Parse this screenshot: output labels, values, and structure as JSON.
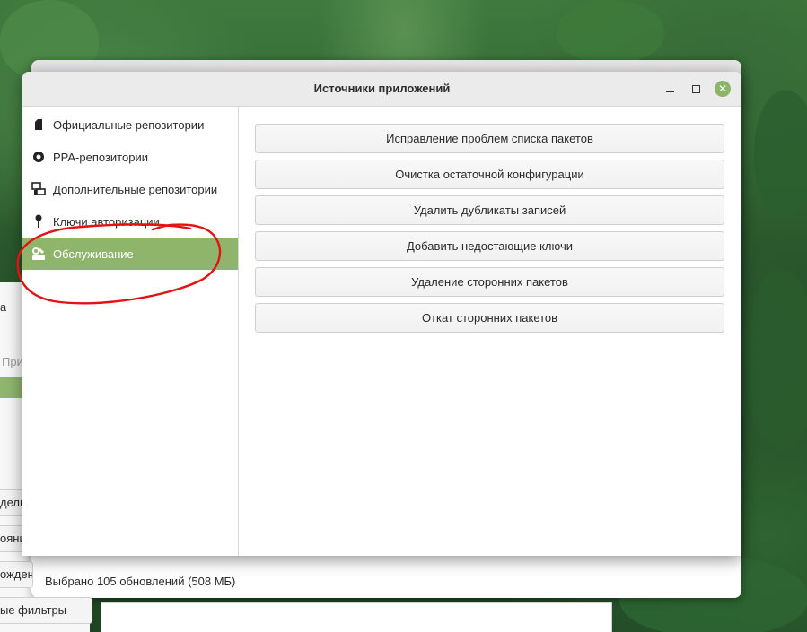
{
  "colors": {
    "accent": "#8fb56d",
    "annotation_red": "#e41212"
  },
  "background_window": {
    "status_text": "Выбрано 105 обновлений (508 МБ)",
    "left_fragments": [
      "а",
      "При",
      "дель",
      "ояни",
      "ожден",
      "ые фильтры"
    ]
  },
  "dialog": {
    "title": "Источники приложений",
    "controls": {
      "minimize_icon": "minimize-icon",
      "maximize_icon": "maximize-icon",
      "close_icon": "close-icon",
      "close_glyph": "✕"
    },
    "sidebar": {
      "items": [
        {
          "label": "Официальные репозитории",
          "icon": "package-icon",
          "selected": false
        },
        {
          "label": "PPA-репозитории",
          "icon": "ppa-icon",
          "selected": false
        },
        {
          "label": "Дополнительные репозитории",
          "icon": "network-icon",
          "selected": false
        },
        {
          "label": "Ключи авторизации",
          "icon": "key-icon",
          "selected": false
        },
        {
          "label": "Обслуживание",
          "icon": "maintenance-icon",
          "selected": true
        }
      ]
    },
    "maintenance": {
      "buttons": [
        "Исправление проблем списка пакетов",
        "Очистка остаточной конфигурации",
        "Удалить дубликаты записей",
        "Добавить недостающие ключи",
        "Удаление сторонних пакетов",
        "Откат сторонних пакетов"
      ]
    }
  }
}
